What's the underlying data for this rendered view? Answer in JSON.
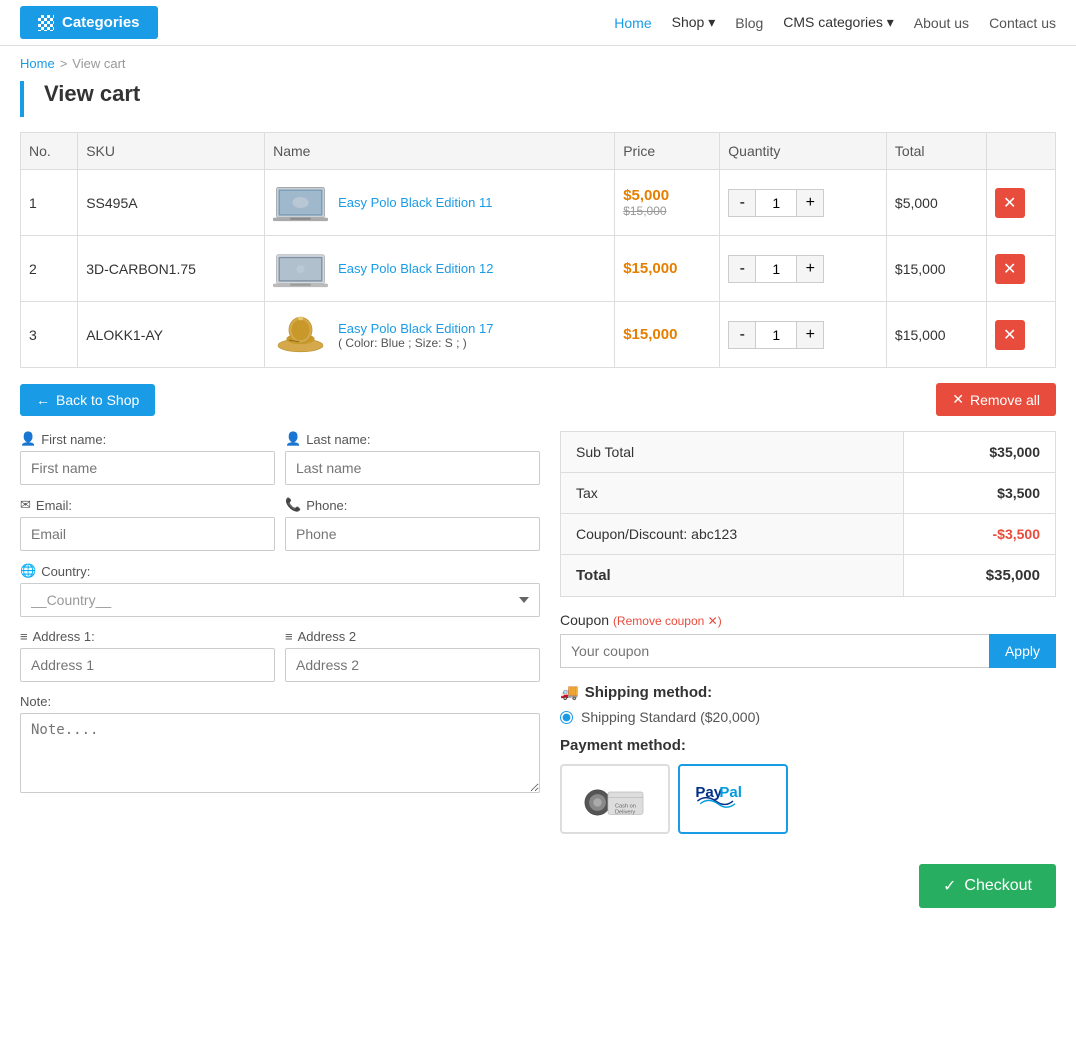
{
  "header": {
    "categories_label": "Categories",
    "nav_items": [
      {
        "label": "Home",
        "active": true
      },
      {
        "label": "Shop",
        "dropdown": true
      },
      {
        "label": "Blog"
      },
      {
        "label": "CMS categories",
        "dropdown": true
      },
      {
        "label": "About us"
      },
      {
        "label": "Contact us"
      }
    ]
  },
  "breadcrumb": {
    "home": "Home",
    "separator": ">",
    "current": "View cart"
  },
  "page_title": "View cart",
  "table": {
    "headers": [
      "No.",
      "SKU",
      "Name",
      "Price",
      "Quantity",
      "Total"
    ],
    "rows": [
      {
        "no": "1",
        "sku": "SS495A",
        "name": "Easy Polo Black Edition 11",
        "price_current": "$5,000",
        "price_old": "$15,000",
        "qty": "1",
        "total": "$5,000",
        "type": "laptop1"
      },
      {
        "no": "2",
        "sku": "3D-CARBON1.75",
        "name": "Easy Polo Black Edition 12",
        "price_current": "$15,000",
        "price_old": "",
        "qty": "1",
        "total": "$15,000",
        "type": "laptop2"
      },
      {
        "no": "3",
        "sku": "ALOKK1-AY",
        "name": "Easy Polo Black Edition 17",
        "name_detail": "( Color: Blue ; Size: S ; )",
        "price_current": "$15,000",
        "price_old": "",
        "qty": "1",
        "total": "$15,000",
        "type": "hat"
      }
    ]
  },
  "buttons": {
    "back_to_shop": "Back to Shop",
    "remove_all": "Remove all",
    "apply": "Apply",
    "checkout": "Checkout"
  },
  "form": {
    "first_name_label": "First name:",
    "last_name_label": "Last name:",
    "first_name_placeholder": "First name",
    "last_name_placeholder": "Last name",
    "email_label": "Email:",
    "phone_label": "Phone:",
    "email_placeholder": "Email",
    "phone_placeholder": "Phone",
    "country_label": "Country:",
    "country_default": "__Country__",
    "address1_label": "Address 1:",
    "address2_label": "Address 2",
    "address1_placeholder": "Address 1",
    "address2_placeholder": "Address 2",
    "note_label": "Note:",
    "note_placeholder": "Note...."
  },
  "summary": {
    "subtotal_label": "Sub Total",
    "subtotal_value": "$35,000",
    "tax_label": "Tax",
    "tax_value": "$3,500",
    "coupon_label": "Coupon/Discount: abc123",
    "coupon_value": "-$3,500",
    "total_label": "Total",
    "total_value": "$35,000"
  },
  "coupon": {
    "label": "Coupon",
    "remove_text": "(Remove coupon ✕)",
    "placeholder": "Your coupon"
  },
  "shipping": {
    "title": "Shipping method:",
    "option": "Shipping Standard ($20,000)"
  },
  "payment": {
    "title": "Payment method:",
    "options": [
      {
        "label": "Cash on Delivery",
        "type": "cod"
      },
      {
        "label": "PayPal",
        "type": "paypal",
        "selected": true
      }
    ]
  }
}
